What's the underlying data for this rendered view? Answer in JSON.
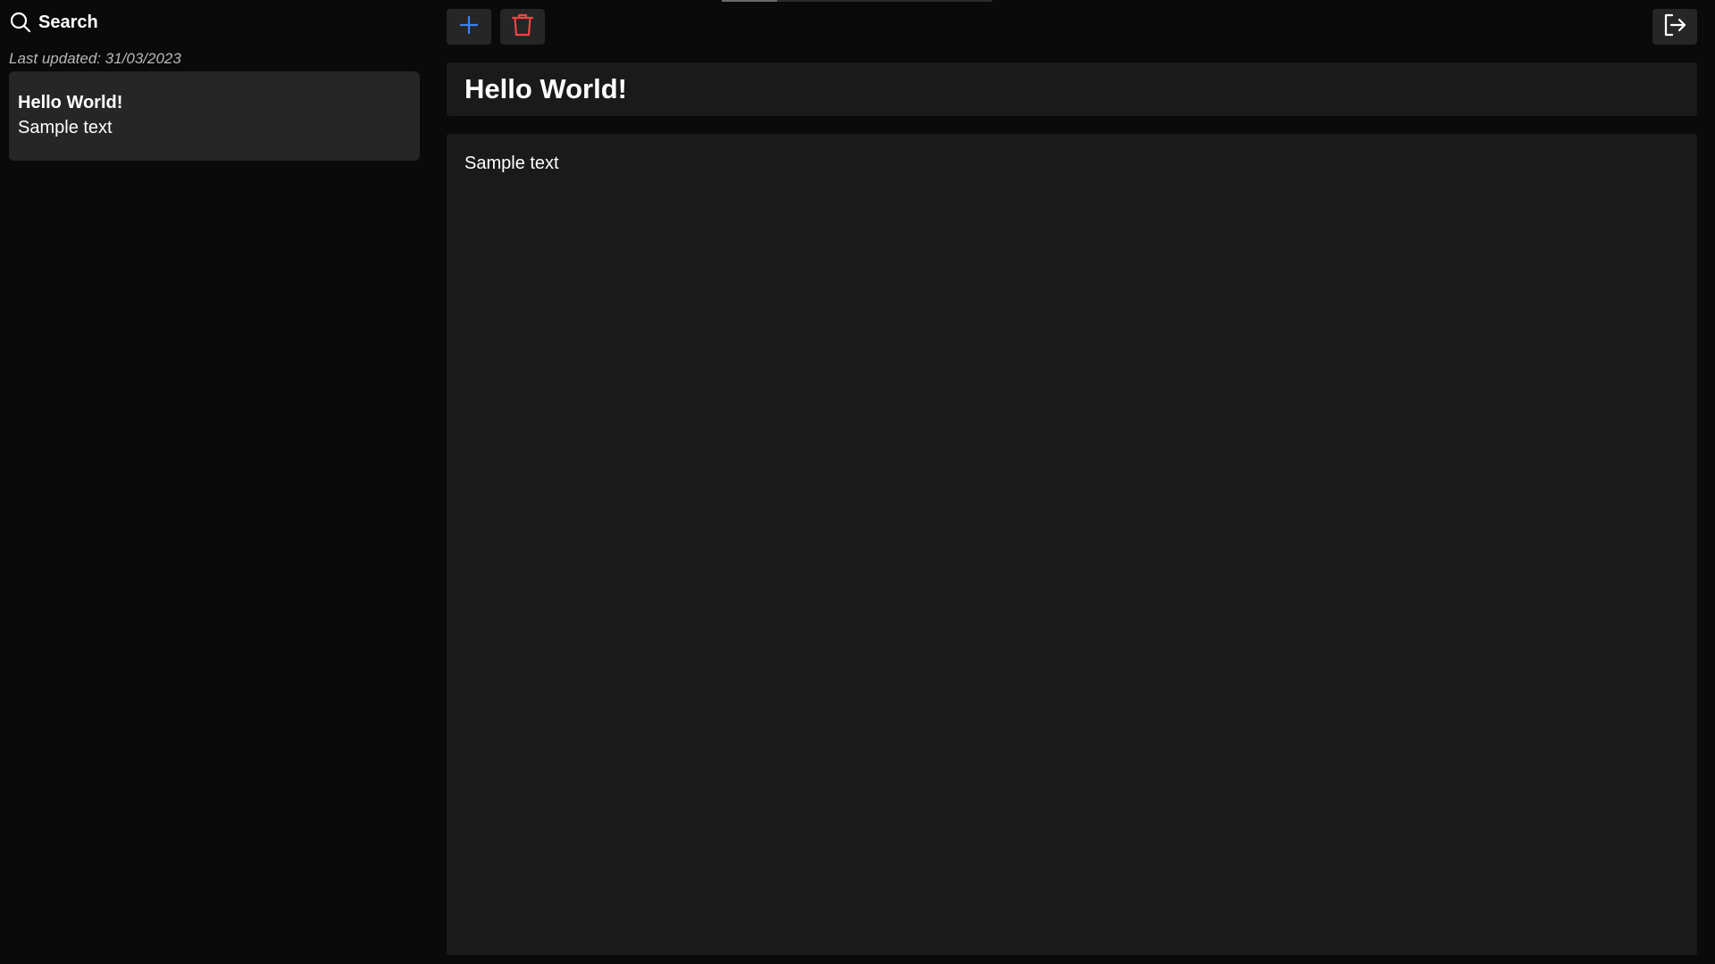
{
  "sidebar": {
    "search_label": "Search",
    "last_updated": "Last updated: 31/03/2023",
    "notes": [
      {
        "title": "Hello World!",
        "preview": "Sample text"
      }
    ]
  },
  "toolbar": {
    "add_icon": "plus-icon",
    "delete_icon": "trash-icon",
    "logout_icon": "logout-icon"
  },
  "editor": {
    "title": "Hello World!",
    "body": "Sample text"
  },
  "colors": {
    "background": "#0a0a0a",
    "panel": "#1a1a1a",
    "card": "#262626",
    "add_accent": "#3b82f6",
    "delete_accent": "#ef4444"
  }
}
